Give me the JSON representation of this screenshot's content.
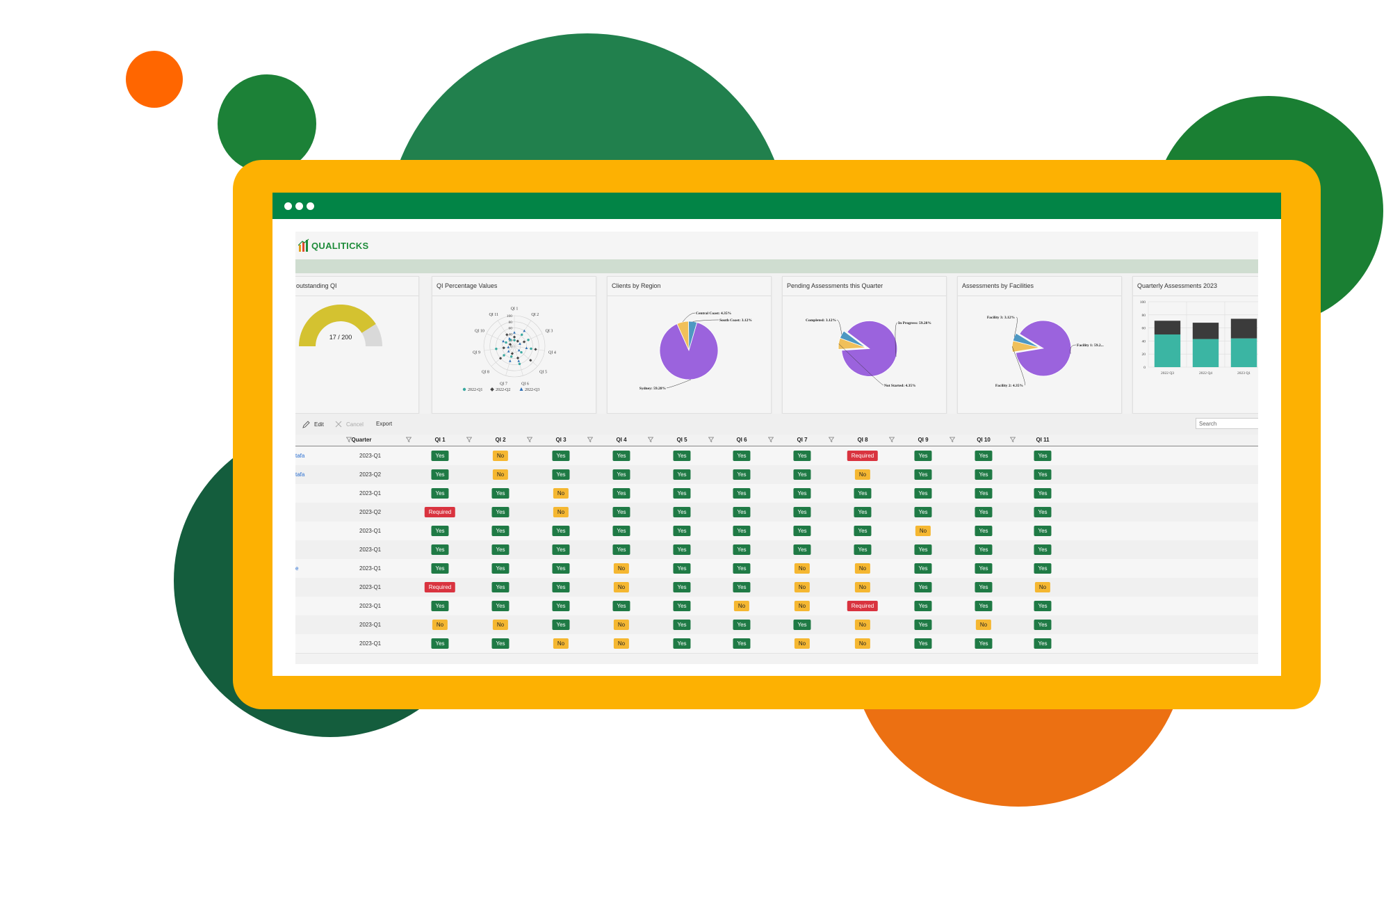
{
  "theme": {
    "frame": "#FDB102",
    "titlebar": "#028446",
    "yes": "#1f7a45",
    "no": "#f5b731",
    "required": "#d9333f",
    "link": "#2a6fd1"
  },
  "app": {
    "brand": "QUALITICKS"
  },
  "cards": {
    "outstanding": {
      "title": "outstanding QI",
      "value": "17 / 200",
      "done": 17,
      "total": 200
    },
    "radar": {
      "title": "QI Percentage Values",
      "axes": [
        "QI 1",
        "QI 2",
        "QI 3",
        "QI 4",
        "QI 5",
        "QI 6",
        "QI 7",
        "QI 8",
        "QI 9",
        "QI 10",
        "QI 11"
      ],
      "ticks": [
        "100",
        "80",
        "60",
        "40",
        "20",
        "0"
      ],
      "legend": [
        "2022-Q1",
        "2022-Q2",
        "2022-Q3"
      ]
    },
    "region": {
      "title": "Clients by Region",
      "labels": [
        "Central Coast: 4.35%",
        "South Coast: 3.12%",
        "Sydney: 59.28%"
      ]
    },
    "pending": {
      "title": "Pending Assessments this Quarter",
      "labels": [
        "Completed: 3.12%",
        "In Progress: 59.28%",
        "Not Started: 4.35%"
      ]
    },
    "facilities": {
      "title": "Assessments by Facilities",
      "labels": [
        "Facility 3: 3.12%",
        "Facility 1: 59.2...",
        "Facility 2: 4.35%"
      ]
    },
    "quarterly": {
      "title": "Quarterly Assessments 2023",
      "yticks": [
        "100",
        "80",
        "60",
        "40",
        "20",
        "0"
      ],
      "categories": [
        "2022 Q3",
        "2022 Q4",
        "2023 Q1"
      ]
    }
  },
  "chart_data": [
    {
      "type": "pie",
      "title": "Clients by Region",
      "slices": [
        {
          "label": "Central Coast",
          "value": 4.35
        },
        {
          "label": "South Coast",
          "value": 3.12
        },
        {
          "label": "Sydney",
          "value": 59.28
        }
      ]
    },
    {
      "type": "pie",
      "title": "Pending Assessments this Quarter",
      "slices": [
        {
          "label": "Completed",
          "value": 3.12
        },
        {
          "label": "In Progress",
          "value": 59.28
        },
        {
          "label": "Not Started",
          "value": 4.35
        }
      ]
    },
    {
      "type": "pie",
      "title": "Assessments by Facilities",
      "slices": [
        {
          "label": "Facility 3",
          "value": 3.12
        },
        {
          "label": "Facility 1",
          "value": 59.28
        },
        {
          "label": "Facility 2",
          "value": 4.35
        }
      ]
    },
    {
      "type": "bar",
      "title": "Quarterly Assessments 2023",
      "categories": [
        "2022 Q3",
        "2022 Q4",
        "2023 Q1"
      ],
      "series": [
        {
          "values": [
            50,
            43,
            44
          ]
        },
        {
          "values": [
            21,
            25,
            30
          ]
        }
      ],
      "ylim": [
        0,
        100
      ],
      "stacked": true
    }
  ],
  "toolbar": {
    "edit": "Edit",
    "cancel": "Cancel",
    "export": "Export",
    "search_placeholder": "Search"
  },
  "table": {
    "columns": [
      "Quarter",
      "QI 1",
      "QI 2",
      "QI 3",
      "QI 4",
      "QI 5",
      "QI 6",
      "QI 7",
      "QI 8",
      "QI 9",
      "QI 10",
      "QI 11"
    ],
    "rows": [
      {
        "name": "tafa",
        "quarter": "2023-Q1",
        "values": [
          "Yes",
          "No",
          "Yes",
          "Yes",
          "Yes",
          "Yes",
          "Yes",
          "Required",
          "Yes",
          "Yes",
          "Yes"
        ]
      },
      {
        "name": "tafa",
        "quarter": "2023-Q2",
        "values": [
          "Yes",
          "No",
          "Yes",
          "Yes",
          "Yes",
          "Yes",
          "Yes",
          "No",
          "Yes",
          "Yes",
          "Yes"
        ]
      },
      {
        "name": "",
        "quarter": "2023-Q1",
        "values": [
          "Yes",
          "Yes",
          "No",
          "Yes",
          "Yes",
          "Yes",
          "Yes",
          "Yes",
          "Yes",
          "Yes",
          "Yes"
        ]
      },
      {
        "name": "",
        "quarter": "2023-Q2",
        "values": [
          "Required",
          "Yes",
          "No",
          "Yes",
          "Yes",
          "Yes",
          "Yes",
          "Yes",
          "Yes",
          "Yes",
          "Yes"
        ]
      },
      {
        "name": "",
        "quarter": "2023-Q1",
        "values": [
          "Yes",
          "Yes",
          "Yes",
          "Yes",
          "Yes",
          "Yes",
          "Yes",
          "Yes",
          "No",
          "Yes",
          "Yes"
        ]
      },
      {
        "name": "",
        "quarter": "2023-Q1",
        "values": [
          "Yes",
          "Yes",
          "Yes",
          "Yes",
          "Yes",
          "Yes",
          "Yes",
          "Yes",
          "Yes",
          "Yes",
          "Yes"
        ]
      },
      {
        "name": "e",
        "quarter": "2023-Q1",
        "values": [
          "Yes",
          "Yes",
          "Yes",
          "No",
          "Yes",
          "Yes",
          "No",
          "No",
          "Yes",
          "Yes",
          "Yes"
        ]
      },
      {
        "name": "",
        "quarter": "2023-Q1",
        "values": [
          "Required",
          "Yes",
          "Yes",
          "No",
          "Yes",
          "Yes",
          "No",
          "No",
          "Yes",
          "Yes",
          "No"
        ]
      },
      {
        "name": "",
        "quarter": "2023-Q1",
        "values": [
          "Yes",
          "Yes",
          "Yes",
          "Yes",
          "Yes",
          "No",
          "No",
          "Required",
          "Yes",
          "Yes",
          "Yes"
        ]
      },
      {
        "name": "",
        "quarter": "2023-Q1",
        "values": [
          "No",
          "No",
          "Yes",
          "No",
          "Yes",
          "Yes",
          "Yes",
          "No",
          "Yes",
          "No",
          "Yes"
        ]
      },
      {
        "name": "",
        "quarter": "2023-Q1",
        "values": [
          "Yes",
          "Yes",
          "No",
          "No",
          "Yes",
          "Yes",
          "No",
          "No",
          "Yes",
          "Yes",
          "Yes"
        ]
      }
    ]
  }
}
